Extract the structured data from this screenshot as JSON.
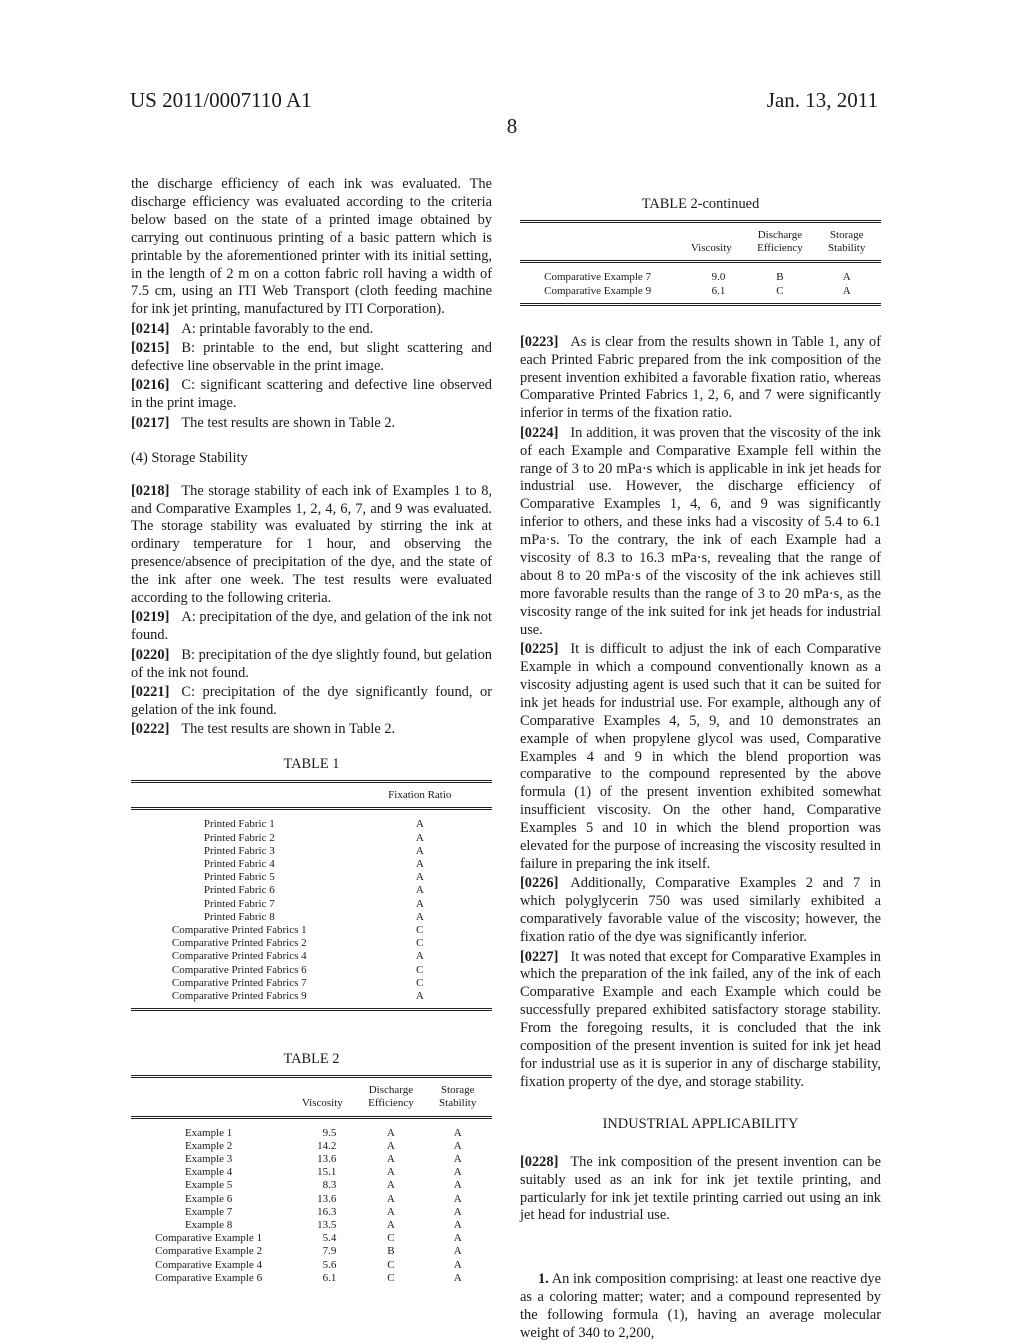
{
  "header": {
    "publication_number": "US 2011/0007110 A1",
    "date": "Jan. 13, 2011",
    "page_number": "8"
  },
  "left_column": {
    "intro_text": "the discharge efficiency of each ink was evaluated. The discharge efficiency was evaluated according to the criteria below based on the state of a printed image obtained by carrying out continuous printing of a basic pattern which is printable by the aforementioned printer with its initial setting, in the length of 2 m on a cotton fabric roll having a width of 7.5 cm, using an ITI Web Transport (cloth feeding machine for ink jet printing, manufactured by ITI Corporation).",
    "paragraphs_a": [
      {
        "num": "[0214]",
        "text": "A: printable favorably to the end."
      },
      {
        "num": "[0215]",
        "text": "B: printable to the end, but slight scattering and defective line observable in the print image."
      },
      {
        "num": "[0216]",
        "text": "C: significant scattering and defective line observed in the print image."
      },
      {
        "num": "[0217]",
        "text": "The test results are shown in Table 2."
      }
    ],
    "section_heading": "(4) Storage Stability",
    "paragraphs_b": [
      {
        "num": "[0218]",
        "text": "The storage stability of each ink of Examples 1 to 8, and Comparative Examples 1, 2, 4, 6, 7, and 9 was evaluated. The storage stability was evaluated by stirring the ink at ordinary temperature for 1 hour, and observing the presence/absence of precipitation of the dye, and the state of the ink after one week. The test results were evaluated according to the following criteria."
      },
      {
        "num": "[0219]",
        "text": "A: precipitation of the dye, and gelation of the ink not found."
      },
      {
        "num": "[0220]",
        "text": "B: precipitation of the dye slightly found, but gelation of the ink not found."
      },
      {
        "num": "[0221]",
        "text": "C: precipitation of the dye significantly found, or gelation of the ink found."
      },
      {
        "num": "[0222]",
        "text": "The test results are shown in Table 2."
      }
    ],
    "table1": {
      "title": "TABLE 1",
      "headers": [
        "",
        "Fixation Ratio"
      ],
      "rows": [
        [
          "Printed Fabric 1",
          "A"
        ],
        [
          "Printed Fabric 2",
          "A"
        ],
        [
          "Printed Fabric 3",
          "A"
        ],
        [
          "Printed Fabric 4",
          "A"
        ],
        [
          "Printed Fabric 5",
          "A"
        ],
        [
          "Printed Fabric 6",
          "A"
        ],
        [
          "Printed Fabric 7",
          "A"
        ],
        [
          "Printed Fabric 8",
          "A"
        ],
        [
          "Comparative Printed Fabrics 1",
          "C"
        ],
        [
          "Comparative Printed Fabrics 2",
          "C"
        ],
        [
          "Comparative Printed Fabrics 4",
          "A"
        ],
        [
          "Comparative Printed Fabrics 6",
          "C"
        ],
        [
          "Comparative Printed Fabrics 7",
          "C"
        ],
        [
          "Comparative Printed Fabrics 9",
          "A"
        ]
      ]
    },
    "table2": {
      "title": "TABLE 2",
      "headers": [
        "",
        "Viscosity",
        "Discharge Efficiency",
        "Storage Stability"
      ],
      "rows": [
        [
          "Example 1",
          "9.5",
          "A",
          "A"
        ],
        [
          "Example 2",
          "14.2",
          "A",
          "A"
        ],
        [
          "Example 3",
          "13.6",
          "A",
          "A"
        ],
        [
          "Example 4",
          "15.1",
          "A",
          "A"
        ],
        [
          "Example 5",
          "8.3",
          "A",
          "A"
        ],
        [
          "Example 6",
          "13.6",
          "A",
          "A"
        ],
        [
          "Example 7",
          "16.3",
          "A",
          "A"
        ],
        [
          "Example 8",
          "13.5",
          "A",
          "A"
        ],
        [
          "Comparative Example 1",
          "5.4",
          "C",
          "A"
        ],
        [
          "Comparative Example 2",
          "7.9",
          "B",
          "A"
        ],
        [
          "Comparative Example 4",
          "5.6",
          "C",
          "A"
        ],
        [
          "Comparative Example 6",
          "6.1",
          "C",
          "A"
        ]
      ]
    }
  },
  "right_column": {
    "table2_continued": {
      "title": "TABLE 2-continued",
      "headers": [
        "",
        "Viscosity",
        "Discharge Efficiency",
        "Storage Stability"
      ],
      "rows": [
        [
          "Comparative Example 7",
          "9.0",
          "B",
          "A"
        ],
        [
          "Comparative Example 9",
          "6.1",
          "C",
          "A"
        ]
      ]
    },
    "paragraphs": [
      {
        "num": "[0223]",
        "text": "As is clear from the results shown in Table 1, any of each Printed Fabric prepared from the ink composition of the present invention exhibited a favorable fixation ratio, whereas Comparative Printed Fabrics 1, 2, 6, and 7 were significantly inferior in terms of the fixation ratio."
      },
      {
        "num": "[0224]",
        "text": "In addition, it was proven that the viscosity of the ink of each Example and Comparative Example fell within the range of 3 to 20 mPa·s which is applicable in ink jet heads for industrial use. However, the discharge efficiency of Comparative Examples 1, 4, 6, and 9 was significantly inferior to others, and these inks had a viscosity of 5.4 to 6.1 mPa·s. To the contrary, the ink of each Example had a viscosity of 8.3 to 16.3 mPa·s, revealing that the range of about 8 to 20 mPa·s of the viscosity of the ink achieves still more favorable results than the range of 3 to 20 mPa·s, as the viscosity range of the ink suited for ink jet heads for industrial use."
      },
      {
        "num": "[0225]",
        "text": "It is difficult to adjust the ink of each Comparative Example in which a compound conventionally known as a viscosity adjusting agent is used such that it can be suited for ink jet heads for industrial use. For example, although any of Comparative Examples 4, 5, 9, and 10 demonstrates an example of when propylene glycol was used, Comparative Examples 4 and 9 in which the blend proportion was comparative to the compound represented by the above formula (1) of the present invention exhibited somewhat insufficient viscosity. On the other hand, Comparative Examples 5 and 10 in which the blend proportion was elevated for the purpose of increasing the viscosity resulted in failure in preparing the ink itself."
      },
      {
        "num": "[0226]",
        "text": "Additionally, Comparative Examples 2 and 7 in which polyglycerin 750 was used similarly exhibited a comparatively favorable value of the viscosity; however, the fixation ratio of the dye was significantly inferior."
      },
      {
        "num": "[0227]",
        "text": "It was noted that except for Comparative Examples in which the preparation of the ink failed, any of the ink of each Comparative Example and each Example which could be successfully prepared exhibited satisfactory storage stability. From the foregoing results, it is concluded that the ink composition of the present invention is suited for ink jet head for industrial use as it is superior in any of discharge stability, fixation property of the dye, and storage stability."
      }
    ],
    "section_heading": "INDUSTRIAL APPLICABILITY",
    "paragraph_0228": {
      "num": "[0228]",
      "text": "The ink composition of the present invention can be suitably used as an ink for ink jet textile printing, and particularly for ink jet textile printing carried out using an ink jet head for industrial use."
    },
    "claim": {
      "num": "1.",
      "text": "An ink composition comprising: at least one reactive dye as a coloring matter; water; and a compound represented by the following formula (1), having an average molecular weight of 340 to 2,200,"
    }
  }
}
